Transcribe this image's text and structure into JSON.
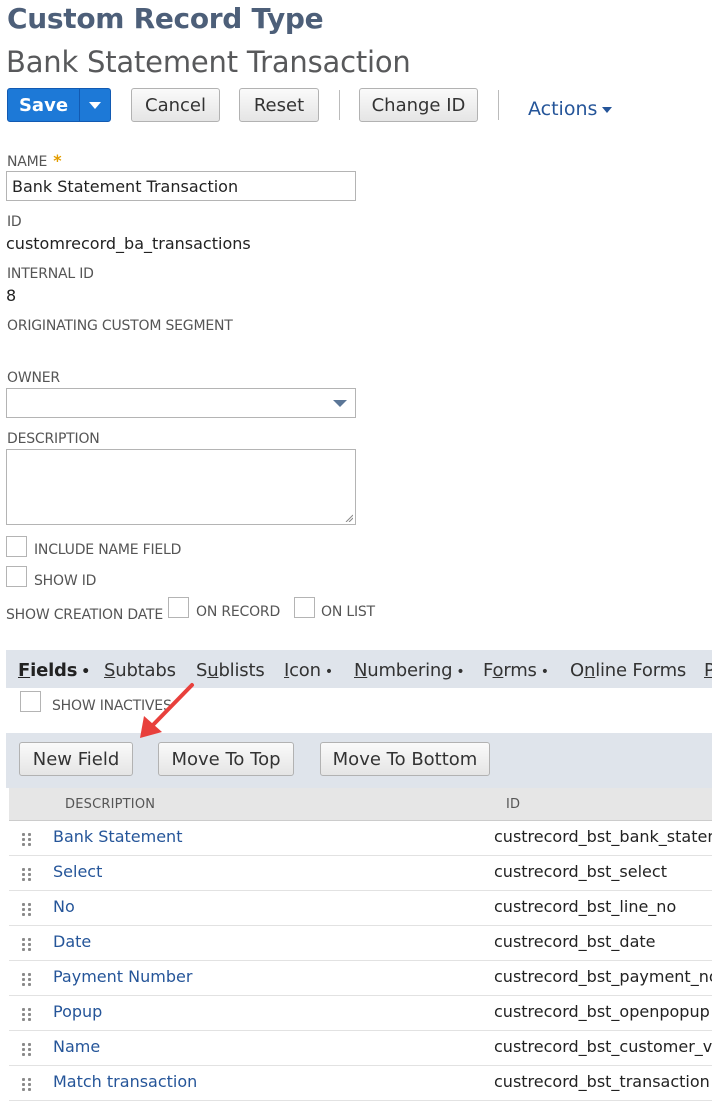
{
  "header": {
    "page_type": "Custom Record Type",
    "record_title": "Bank Statement Transaction"
  },
  "toolbar": {
    "save_label": "Save",
    "cancel_label": "Cancel",
    "reset_label": "Reset",
    "change_id_label": "Change ID",
    "actions_label": "Actions"
  },
  "form": {
    "name_label": "NAME",
    "name_required_mark": "*",
    "name_value": "Bank Statement Transaction",
    "id_label": "ID",
    "id_value": "customrecord_ba_transactions",
    "internal_id_label": "INTERNAL ID",
    "internal_id_value": "8",
    "originating_segment_label": "ORIGINATING CUSTOM SEGMENT",
    "owner_label": "OWNER",
    "owner_value": "",
    "description_label": "DESCRIPTION",
    "description_value": "",
    "include_name_field_label": "INCLUDE NAME FIELD",
    "show_id_label": "SHOW ID",
    "show_creation_date_label": "SHOW CREATION DATE",
    "on_record_label": "ON RECORD",
    "on_list_label": "ON LIST"
  },
  "tabs": [
    {
      "label": "Fields",
      "mnemonic_index": 0,
      "dot": true,
      "active": true
    },
    {
      "label": "Subtabs",
      "mnemonic_index": 0,
      "dot": false,
      "active": false
    },
    {
      "label": "Sublists",
      "mnemonic_index": 1,
      "dot": false,
      "active": false
    },
    {
      "label": "Icon",
      "mnemonic_index": 0,
      "dot": true,
      "active": false
    },
    {
      "label": "Numbering",
      "mnemonic_index": 0,
      "dot": true,
      "active": false
    },
    {
      "label": "Forms",
      "mnemonic_index": 1,
      "dot": true,
      "active": false
    },
    {
      "label": "Online Forms",
      "mnemonic_index": 1,
      "dot": false,
      "active": false
    },
    {
      "label": "P",
      "mnemonic_index": 0,
      "dot": false,
      "active": false
    }
  ],
  "fields_tab": {
    "show_inactives_label": "SHOW INACTIVES",
    "new_field_label": "New Field",
    "move_to_top_label": "Move To Top",
    "move_to_bottom_label": "Move To Bottom",
    "columns": [
      "DESCRIPTION",
      "ID"
    ],
    "rows": [
      {
        "description": "Bank Statement",
        "id": "custrecord_bst_bank_stateme"
      },
      {
        "description": "Select",
        "id": "custrecord_bst_select"
      },
      {
        "description": "No",
        "id": "custrecord_bst_line_no"
      },
      {
        "description": "Date",
        "id": "custrecord_bst_date"
      },
      {
        "description": "Payment Number",
        "id": "custrecord_bst_payment_no"
      },
      {
        "description": "Popup",
        "id": "custrecord_bst_openpopup"
      },
      {
        "description": "Name",
        "id": "custrecord_bst_customer_ver"
      },
      {
        "description": "Match transaction",
        "id": "custrecord_bst_transaction"
      }
    ]
  },
  "colors": {
    "heading": "#4d5f79",
    "primary_button": "#1d79d7",
    "link": "#255599",
    "tabbar_bg": "#dfe4eb",
    "annotation_arrow": "#e8403c"
  },
  "icons": {
    "save_menu": "triangle-down-icon",
    "actions_menu": "caret-down-icon",
    "owner_select": "chevron-down-icon",
    "row_drag": "drag-handle-icon",
    "annotation": "red-arrow-icon"
  }
}
